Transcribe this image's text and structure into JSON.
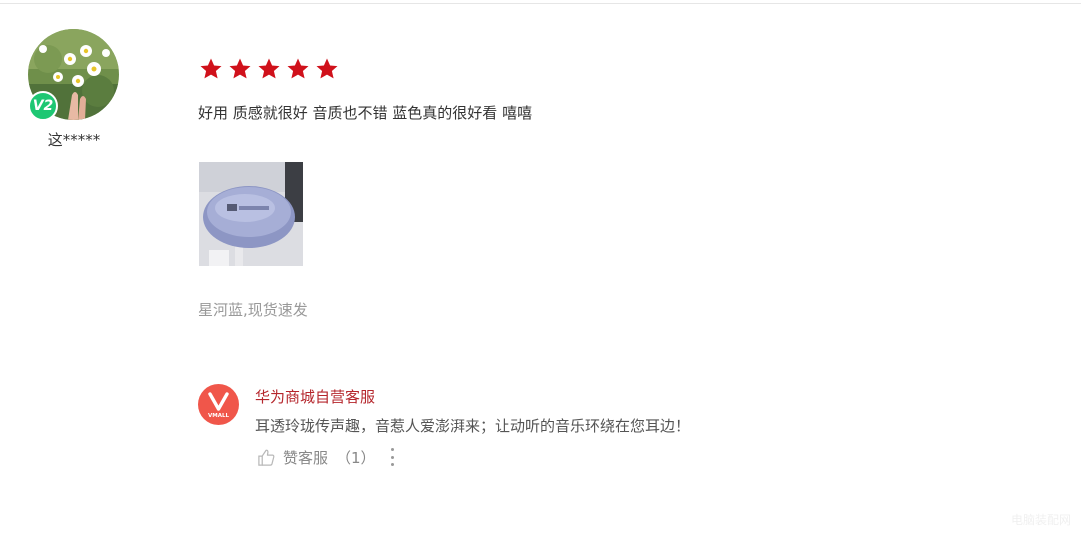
{
  "reviewer": {
    "vip_level": "V2",
    "username": "这*****"
  },
  "review": {
    "rating": 5,
    "rating_max": 5,
    "star_color": "#d0111b",
    "text": "好用 质感就很好 音质也不错 蓝色真的很好看 嘻嘻",
    "variant": "星河蓝,现货速发"
  },
  "reply": {
    "logo_text": "VMALL",
    "merchant_name": "华为商城自营客服",
    "text": "耳透玲珑传声趣，音惹人爱澎湃来；让动听的音乐环绕在您耳边！",
    "like_label": "赞客服",
    "like_count": "（1）"
  },
  "watermark": "电脑装配网",
  "icons": [
    "star-icon",
    "thumbs-up-icon",
    "more-vertical-icon",
    "vip-badge-icon"
  ],
  "colors": {
    "accent_red": "#d0111b",
    "merchant_name": "#b5262c",
    "vip_green": "#1ec773",
    "vmall_logo": "#f0564a"
  }
}
